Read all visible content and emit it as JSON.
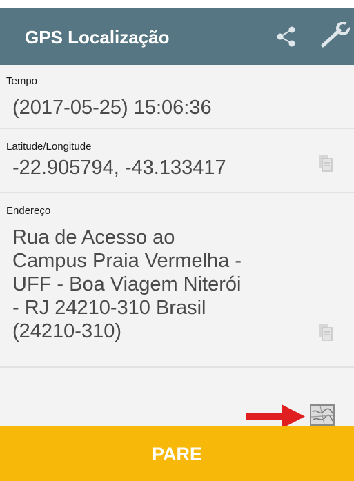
{
  "app_bar": {
    "title": "GPS Localização",
    "background": "#577683",
    "actions": [
      {
        "icon": "share-icon"
      },
      {
        "icon": "wrench-icon"
      }
    ]
  },
  "fields": {
    "time": {
      "label": "Tempo",
      "value": "(2017-05-25) 15:06:36"
    },
    "coordinates": {
      "label": "Latitude/Longitude",
      "value": "-22.905794, -43.133417",
      "action_icon": "copy-icon"
    },
    "address": {
      "label": "Endereço",
      "lines": [
        "Rua de Acesso ao",
        "Campus Praia Vermelha -",
        "UFF - Boa Viagem Niterói",
        "- RJ 24210-310 Brasil",
        "(24210-310)"
      ],
      "action_icon": "copy-icon"
    }
  },
  "map_button": {
    "icon": "map-icon"
  },
  "annotation": {
    "icon": "arrow-right-icon",
    "color": "#e02020"
  },
  "stop_button": {
    "label": "PARE",
    "background": "#f8b80a"
  }
}
